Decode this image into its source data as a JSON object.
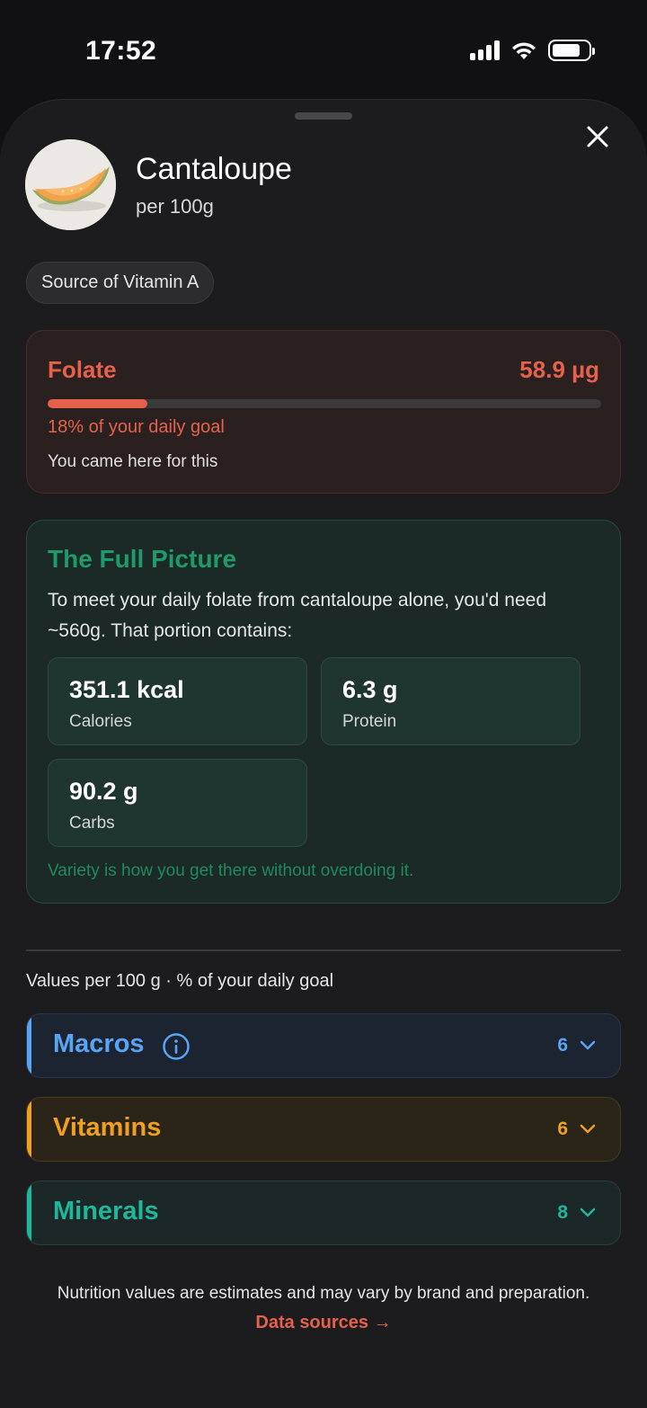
{
  "status": {
    "time": "17:52"
  },
  "food": {
    "name": "Cantaloupe",
    "serving": "per 100g"
  },
  "tag": "Source of Vitamin A",
  "folate": {
    "name": "Folate",
    "value": "58.9 µg",
    "progress": 0.18,
    "percent_text": "18% of your daily goal",
    "note": "You came here for this",
    "color": "#e6614b"
  },
  "full_picture": {
    "title": "The Full Picture",
    "text": "To meet your daily folate from cantaloupe alone, you'd need ~560g. That portion contains:",
    "stats": [
      {
        "value": "351.1 kcal",
        "label": "Calories"
      },
      {
        "value": "6.3 g",
        "label": "Protein"
      },
      {
        "value": "90.2 g",
        "label": "Carbs"
      }
    ],
    "footer": "Variety is how you get there without overdoing it."
  },
  "values_caption": "Values per 100 g · % of your daily goal",
  "sections": [
    {
      "label": "Macros",
      "count": "6",
      "color": "#5aa4f5",
      "bg": "#1d2431",
      "border": "#2a3650"
    },
    {
      "label": "Vitamins",
      "count": "6",
      "color": "#f0a020",
      "bg": "#2b2419",
      "border": "#4a3a1e"
    },
    {
      "label": "Minerals",
      "count": "8",
      "color": "#1fb79a",
      "bg": "#1b2827",
      "border": "#23403c"
    }
  ],
  "footer": {
    "note": "Nutrition values are estimates and may vary by brand and preparation.",
    "link": "Data sources →"
  }
}
